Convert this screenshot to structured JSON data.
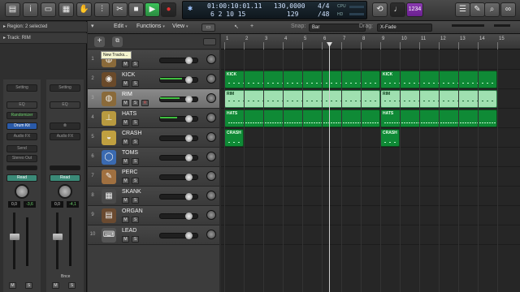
{
  "control_bar": {
    "lcd_position": "01:00:10:01.11",
    "lcd_bars": "6  2  10  15",
    "lcd_tempo": "130,0000",
    "lcd_tempo_sub": "129",
    "lcd_signature": "4/4",
    "lcd_division": "/48",
    "lcd_cpu": "CPU",
    "lcd_hd": "HD",
    "count_in_label": "1234"
  },
  "inspector": {
    "region_row": "Region: 2 selected",
    "track_row": "Track:  RIM",
    "strip1": {
      "setting": "Setting",
      "eq": "EQ",
      "midi_fx": "Randomizer",
      "instrument": "Drum Kit",
      "audio_fx": "Audio FX",
      "send": "Send",
      "output": "Stereo Out",
      "automation": "Read",
      "val_left": "0,0",
      "val_right": "-3,6",
      "mute": "M",
      "solo": "S"
    },
    "strip2": {
      "setting": "Setting",
      "eq": "EQ",
      "audio_fx": "Audio FX",
      "automation": "Read",
      "val_left": "0,0",
      "val_right": "-4,1",
      "name": "Bnce",
      "mute": "M",
      "solo": "S"
    }
  },
  "track_area": {
    "edit_menu": "Edit",
    "functions_menu": "Functions",
    "view_menu": "View",
    "snap_label": "Snap:",
    "snap_value": "Bar",
    "drag_label": "Drag:",
    "drag_value": "X-Fade",
    "tooltip": "New Tracks..."
  },
  "ruler": [
    "1",
    "2",
    "3",
    "4",
    "5",
    "6",
    "7",
    "8",
    "9",
    "10",
    "11",
    "12",
    "13",
    "14",
    "15"
  ],
  "tracks": [
    {
      "num": "1",
      "name": "",
      "selected": false,
      "icon": "snare-drum-icon",
      "meter": 0
    },
    {
      "num": "2",
      "name": "KICK",
      "selected": false,
      "icon": "kick-drum-icon",
      "meter": 0.9
    },
    {
      "num": "3",
      "name": "RIM",
      "selected": true,
      "icon": "snare-drum-icon",
      "meter": 0.8
    },
    {
      "num": "4",
      "name": "HATS",
      "selected": false,
      "icon": "hihat-icon",
      "meter": 0.7
    },
    {
      "num": "5",
      "name": "CRASH",
      "selected": false,
      "icon": "cymbal-icon",
      "meter": 0
    },
    {
      "num": "6",
      "name": "TOMS",
      "selected": false,
      "icon": "tom-icon",
      "meter": 0
    },
    {
      "num": "7",
      "name": "PERC",
      "selected": false,
      "icon": "shaker-icon",
      "meter": 0
    },
    {
      "num": "8",
      "name": "SKANK",
      "selected": false,
      "icon": "amp-icon",
      "meter": 0
    },
    {
      "num": "9",
      "name": "ORGAN",
      "selected": false,
      "icon": "organ-icon",
      "meter": 0
    },
    {
      "num": "10",
      "name": "LEAD",
      "selected": false,
      "icon": "synth-icon",
      "meter": 0
    }
  ],
  "regions": [
    {
      "lane": 1,
      "start": 1,
      "end": 9,
      "label": "KICK",
      "light": false
    },
    {
      "lane": 1,
      "start": 9,
      "end": 15,
      "label": "KICK",
      "light": false
    },
    {
      "lane": 2,
      "start": 1,
      "end": 9,
      "label": "RIM",
      "light": true
    },
    {
      "lane": 2,
      "start": 9,
      "end": 15,
      "label": "RIM",
      "light": true
    },
    {
      "lane": 3,
      "start": 1,
      "end": 9,
      "label": "HATS",
      "light": false
    },
    {
      "lane": 3,
      "start": 9,
      "end": 15,
      "label": "HATS",
      "light": false
    },
    {
      "lane": 4,
      "start": 1,
      "end": 2,
      "label": "CRASH",
      "light": false
    },
    {
      "lane": 4,
      "start": 9,
      "end": 10,
      "label": "CRASH",
      "light": false
    }
  ],
  "colors": {
    "region_green": "#0f8a36",
    "region_light": "#9fe0b0",
    "play_green": "#2fa84a"
  }
}
